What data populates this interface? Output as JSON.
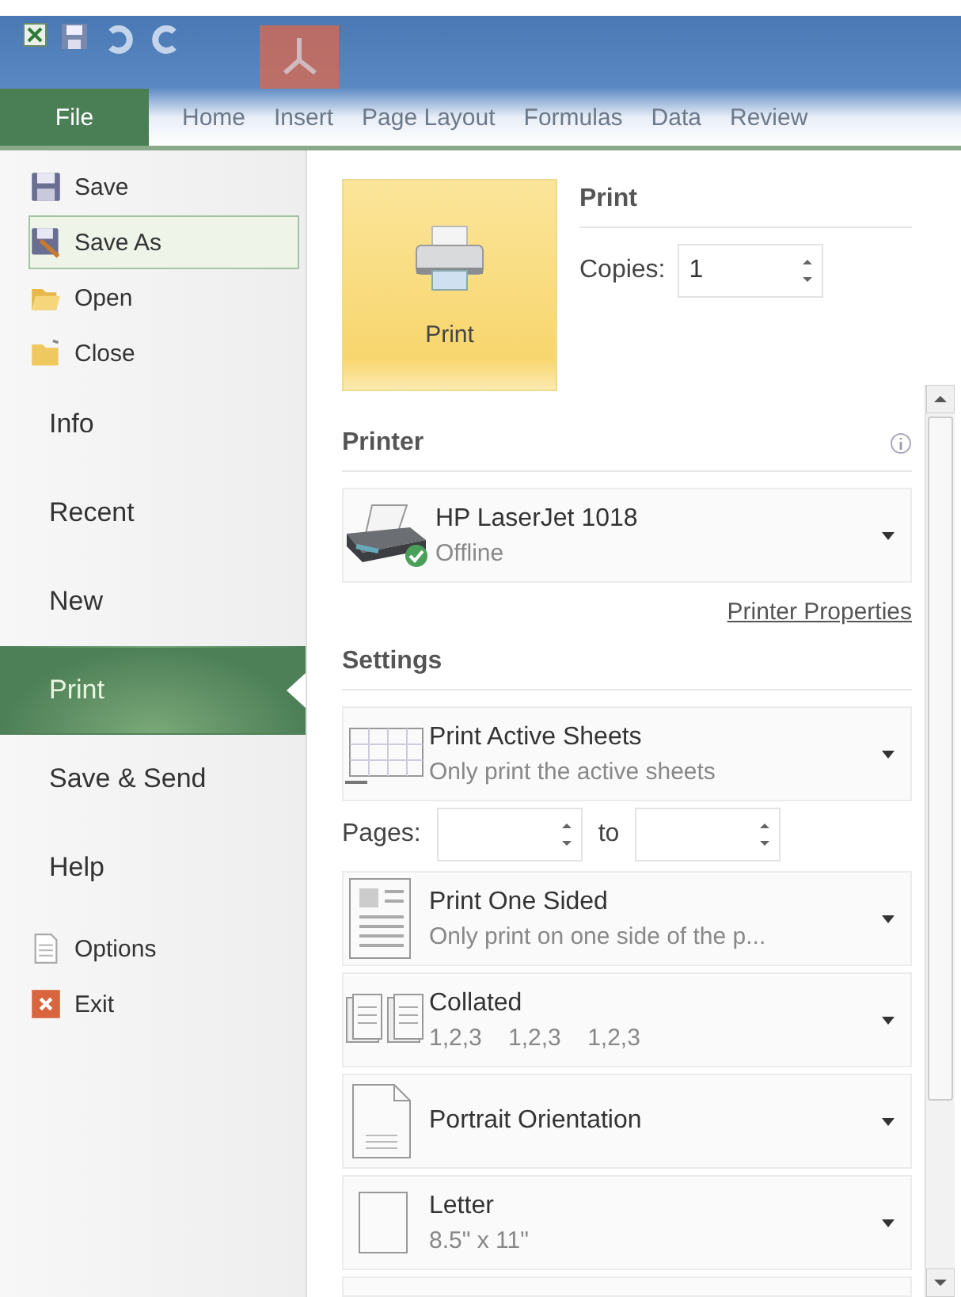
{
  "ribbon": {
    "tabs": [
      {
        "label": "File",
        "selected": true
      },
      {
        "label": "Home",
        "selected": false
      },
      {
        "label": "Insert",
        "selected": false
      },
      {
        "label": "Page Layout",
        "selected": false
      },
      {
        "label": "Formulas",
        "selected": false
      },
      {
        "label": "Data",
        "selected": false
      },
      {
        "label": "Review",
        "selected": false
      }
    ]
  },
  "sidebar": {
    "items": [
      {
        "label": "Save",
        "kind": "command",
        "selected": false,
        "hovered": false
      },
      {
        "label": "Save As",
        "kind": "command",
        "selected": false,
        "hovered": true
      },
      {
        "label": "Open",
        "kind": "command",
        "selected": false,
        "hovered": false
      },
      {
        "label": "Close",
        "kind": "command",
        "selected": false,
        "hovered": false
      },
      {
        "label": "Info",
        "kind": "section",
        "selected": false,
        "hovered": false
      },
      {
        "label": "Recent",
        "kind": "section",
        "selected": false,
        "hovered": false
      },
      {
        "label": "New",
        "kind": "section",
        "selected": false,
        "hovered": false
      },
      {
        "label": "Print",
        "kind": "section",
        "selected": true,
        "hovered": false
      },
      {
        "label": "Save & Send",
        "kind": "section",
        "selected": false,
        "hovered": false
      },
      {
        "label": "Help",
        "kind": "section",
        "selected": false,
        "hovered": false
      },
      {
        "label": "Options",
        "kind": "command",
        "selected": false,
        "hovered": false
      },
      {
        "label": "Exit",
        "kind": "command",
        "selected": false,
        "hovered": false
      }
    ]
  },
  "print": {
    "button": "Print",
    "heading": "Print",
    "copies_label": "Copies:",
    "copies": "1"
  },
  "printer": {
    "heading": "Printer",
    "name": "HP LaserJet 1018",
    "status": "Offline",
    "properties_link": "Printer Properties"
  },
  "settings": {
    "heading": "Settings",
    "options": [
      {
        "kind": "dropdown",
        "title": "Print Active Sheets",
        "subtitle": "Only print the active sheets"
      },
      {
        "kind": "pages",
        "label": "Pages:",
        "to": "to"
      },
      {
        "kind": "dropdown",
        "title": "Print One Sided",
        "subtitle": "Only print on one side of the p..."
      },
      {
        "kind": "dropdown",
        "title": "Collated",
        "subtitle": "1,2,3    1,2,3    1,2,3"
      },
      {
        "kind": "dropdown",
        "title": "Portrait Orientation"
      },
      {
        "kind": "dropdown",
        "title": "Letter",
        "subtitle": "8.5\" x 11\""
      }
    ]
  }
}
